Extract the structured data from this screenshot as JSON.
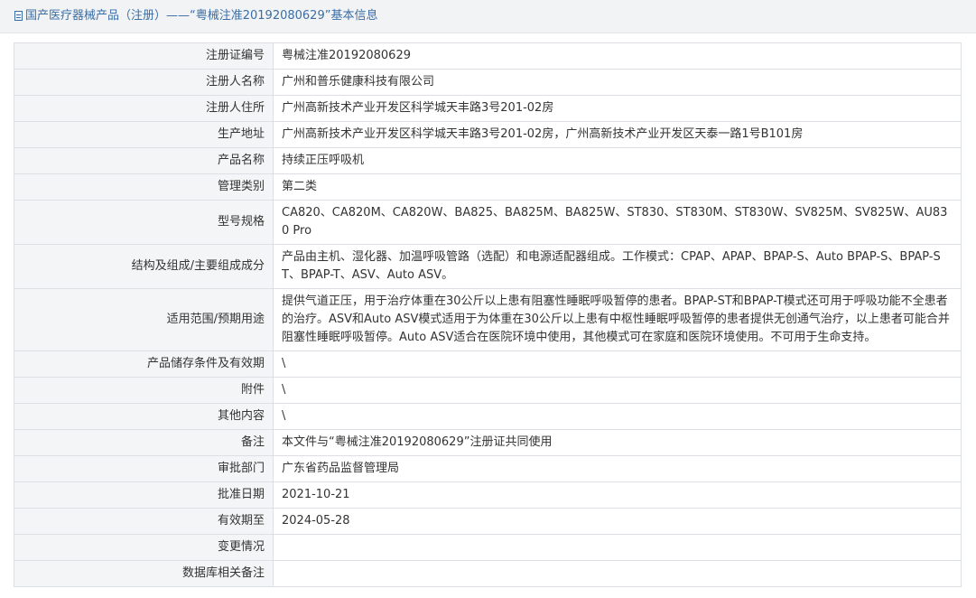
{
  "header": {
    "title": "国产医疗器械产品（注册）——“粤械注准20192080629”基本信息",
    "icon": "document-icon"
  },
  "rows": [
    {
      "label": "注册证编号",
      "value": "粤械注准20192080629"
    },
    {
      "label": "注册人名称",
      "value": "广州和普乐健康科技有限公司"
    },
    {
      "label": "注册人住所",
      "value": "广州高新技术产业开发区科学城天丰路3号201-02房"
    },
    {
      "label": "生产地址",
      "value": "广州高新技术产业开发区科学城天丰路3号201-02房，广州高新技术产业开发区天泰一路1号B101房"
    },
    {
      "label": "产品名称",
      "value": "持续正压呼吸机"
    },
    {
      "label": "管理类别",
      "value": "第二类"
    },
    {
      "label": "型号规格",
      "value": "CA820、CA820M、CA820W、BA825、BA825M、BA825W、ST830、ST830M、ST830W、SV825M、SV825W、AU830 Pro"
    },
    {
      "label": "结构及组成/主要组成成分",
      "value": "产品由主机、湿化器、加温呼吸管路（选配）和电源适配器组成。工作模式：CPAP、APAP、BPAP-S、Auto BPAP-S、BPAP-ST、BPAP-T、ASV、Auto ASV。"
    },
    {
      "label": "适用范围/预期用途",
      "value": "提供气道正压，用于治疗体重在30公斤以上患有阻塞性睡眠呼吸暂停的患者。BPAP-ST和BPAP-T模式还可用于呼吸功能不全患者的治疗。ASV和Auto ASV模式适用于为体重在30公斤以上患有中枢性睡眠呼吸暂停的患者提供无创通气治疗，以上患者可能合并阻塞性睡眠呼吸暂停。Auto ASV适合在医院环境中使用，其他模式可在家庭和医院环境使用。不可用于生命支持。"
    },
    {
      "label": "产品储存条件及有效期",
      "value": "\\"
    },
    {
      "label": "附件",
      "value": "\\"
    },
    {
      "label": "其他内容",
      "value": "\\"
    },
    {
      "label": "备注",
      "value": "本文件与“粤械注准20192080629”注册证共同使用"
    },
    {
      "label": "审批部门",
      "value": "广东省药品监督管理局"
    },
    {
      "label": "批准日期",
      "value": "2021-10-21"
    },
    {
      "label": "有效期至",
      "value": "2024-05-28"
    },
    {
      "label": "变更情况",
      "value": ""
    },
    {
      "label": "数据库相关备注",
      "value": ""
    }
  ]
}
